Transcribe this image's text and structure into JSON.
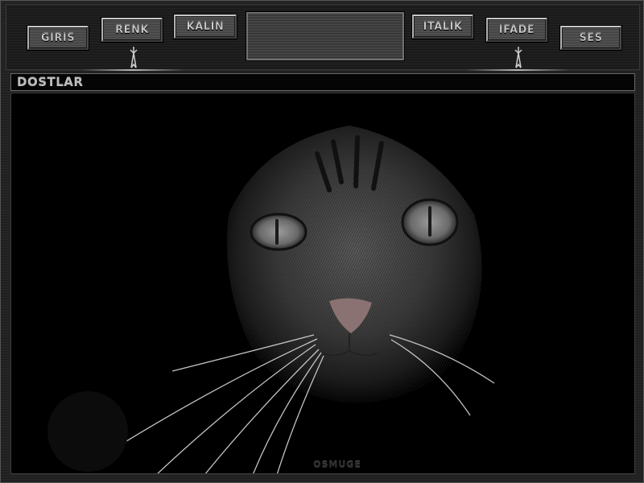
{
  "nav": {
    "giris": "GIRIS",
    "renk": "RENK",
    "kalin": "KALIN",
    "italik": "ITALIK",
    "ifade": "IFADE",
    "ses": "SES"
  },
  "section": {
    "title": "DOSTLAR"
  },
  "content": {
    "image": "cat-face-photo"
  },
  "footer": {
    "signature": "OSMUGE"
  },
  "colors": {
    "frame": "#2b2b2b",
    "button_face": "#4a4a4a",
    "text": "#cfcfcf",
    "content_bg": "#000000"
  }
}
